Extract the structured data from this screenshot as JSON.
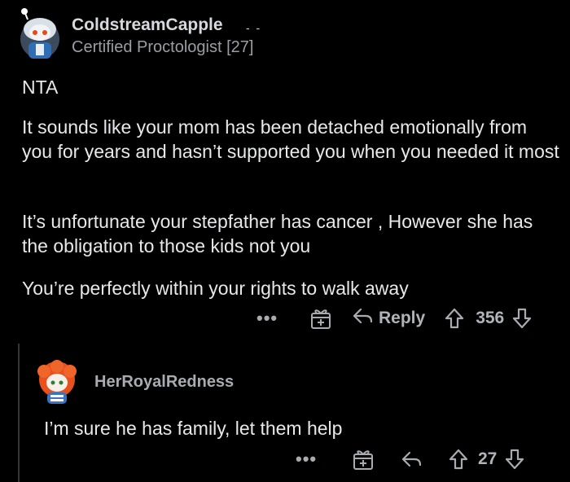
{
  "comment": {
    "username": "ColdstreamCapple",
    "flair": "Certified Proctologist [27]",
    "paragraphs": [
      "NTA",
      "It sounds like your mom has been detached emotionally from you for years and hasn’t supported you when you needed it most",
      "It’s unfortunate your stepfather has cancer , However she has the obligation to those kids not you",
      "You’re perfectly within your rights to walk away"
    ],
    "actions": {
      "more": "•••",
      "reply_label": "Reply",
      "vote_count": "356"
    }
  },
  "reply": {
    "username": "HerRoyalRedness",
    "text": "I’m sure he has family, let them help",
    "actions": {
      "more": "•••",
      "vote_count": "27"
    }
  },
  "icons": [
    "avatar",
    "more-icon",
    "award-icon",
    "reply-icon",
    "upvote-icon",
    "downvote-icon"
  ],
  "colors": {
    "background": "#000000",
    "text": "#d7dadc",
    "muted": "#9a9ea2",
    "thread_line": "#343536"
  }
}
